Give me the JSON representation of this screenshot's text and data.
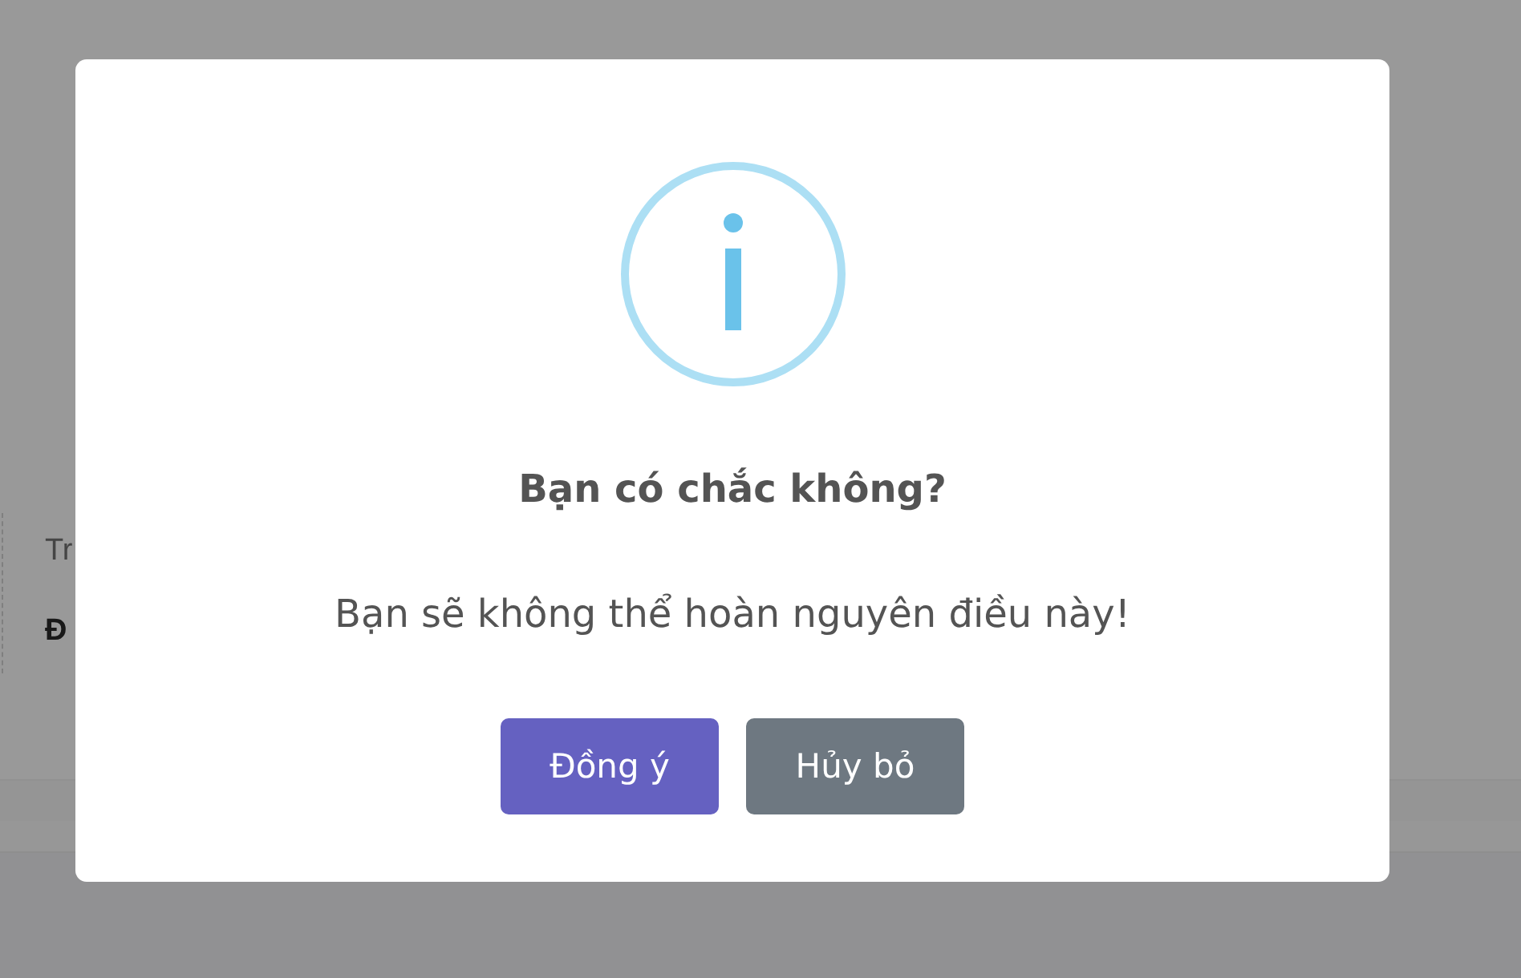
{
  "page": {
    "fields": [
      {
        "kind": "label",
        "text": "Tr"
      },
      {
        "kind": "value",
        "text": "Đ"
      }
    ]
  },
  "dialog": {
    "title": "Bạn có chắc không?",
    "message": "Bạn sẽ không thể hoàn nguyên điều này!",
    "buttons": [
      {
        "kind": "confirm",
        "label": "Đồng ý"
      },
      {
        "kind": "cancel",
        "label": "Hủy bỏ"
      }
    ]
  }
}
